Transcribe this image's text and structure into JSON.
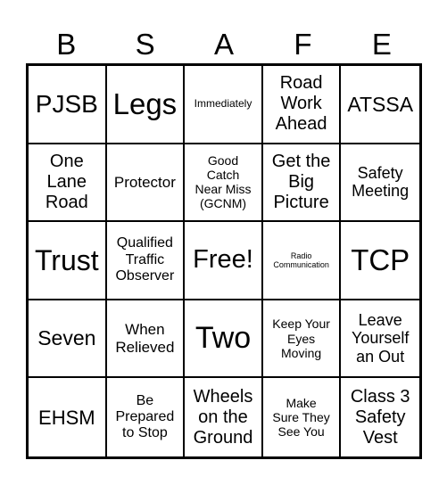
{
  "header": {
    "letters": [
      "B",
      "S",
      "A",
      "F",
      "E"
    ]
  },
  "cells": [
    "PJSB",
    "Legs",
    "Immediately",
    "Road\nWork\nAhead",
    "ATSSA",
    "One\nLane\nRoad",
    "Protector",
    "Good\nCatch\nNear Miss\n(GCNM)",
    "Get the\nBig\nPicture",
    "Safety\nMeeting",
    "Trust",
    "Qualified\nTraffic\nObserver",
    "Free!",
    "Radio\nCommunication",
    "TCP",
    "Seven",
    "When\nRelieved",
    "Two",
    "Keep Your\nEyes\nMoving",
    "Leave\nYourself\nan Out",
    "EHSM",
    "Be\nPrepared\nto Stop",
    "Wheels\non the\nGround",
    "Make\nSure They\nSee You",
    "Class 3\nSafety\nVest"
  ]
}
